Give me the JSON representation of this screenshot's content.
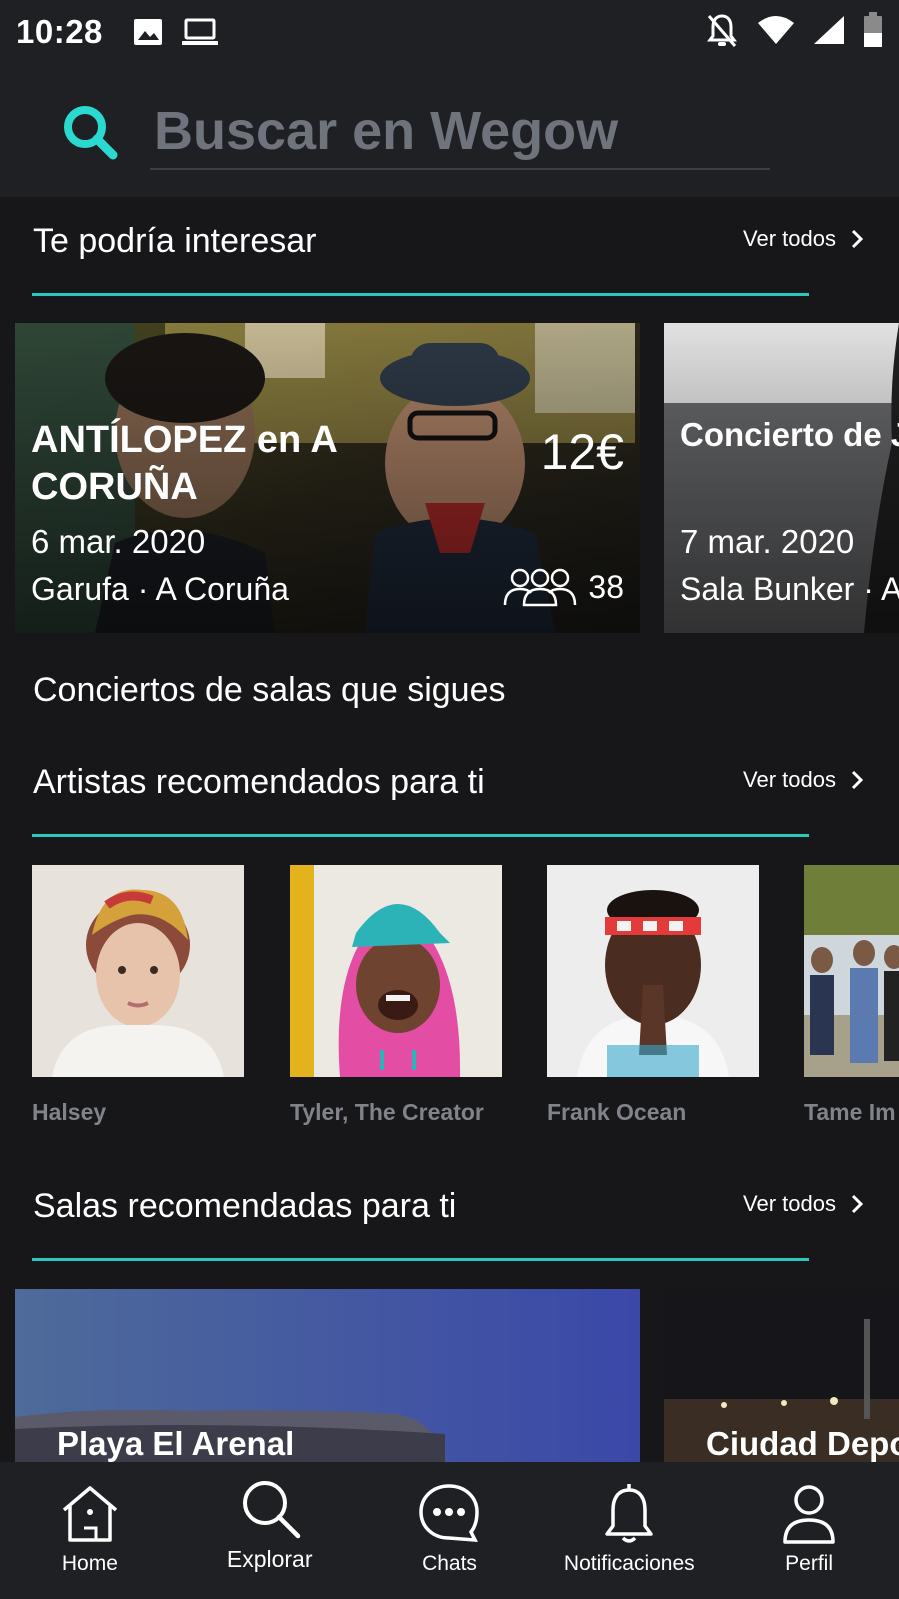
{
  "status_bar": {
    "time": "10:28",
    "icons": [
      "image-icon",
      "laptop-icon",
      "notifications-off-icon",
      "wifi-icon",
      "signal-icon",
      "battery-icon"
    ]
  },
  "search": {
    "placeholder": "Buscar en Wegow"
  },
  "accent_color": "#2bc8be",
  "sections": {
    "interest": {
      "title": "Te podría interesar",
      "see_all": "Ver todos"
    },
    "followed_venues": {
      "title": "Conciertos de salas que sigues"
    },
    "artists": {
      "title": "Artistas recomendados para ti",
      "see_all": "Ver todos"
    },
    "venues": {
      "title": "Salas recomendadas para ti",
      "see_all": "Ver todos"
    }
  },
  "events": [
    {
      "title": "ANTÍLOPEZ en A CORUÑA",
      "price": "12€",
      "date": "6 mar. 2020",
      "venue": "Garufa · A Coruña",
      "attendees": "38"
    },
    {
      "title": "Concierto de J Crepúsculo en",
      "date": "7 mar. 2020",
      "venue": "Sala Bunker · A"
    }
  ],
  "artists": [
    {
      "name": "Halsey"
    },
    {
      "name": "Tyler, The Creator"
    },
    {
      "name": "Frank Ocean"
    },
    {
      "name": "Tame Im"
    }
  ],
  "venues": [
    {
      "name": "Playa El Arenal"
    },
    {
      "name": "Ciudad Depo"
    }
  ],
  "bottom_nav": [
    {
      "label": "Home",
      "icon": "home-icon"
    },
    {
      "label": "Explorar",
      "icon": "search-icon"
    },
    {
      "label": "Chats",
      "icon": "chat-icon"
    },
    {
      "label": "Notificaciones",
      "icon": "bell-icon"
    },
    {
      "label": "Perfil",
      "icon": "user-icon"
    }
  ]
}
